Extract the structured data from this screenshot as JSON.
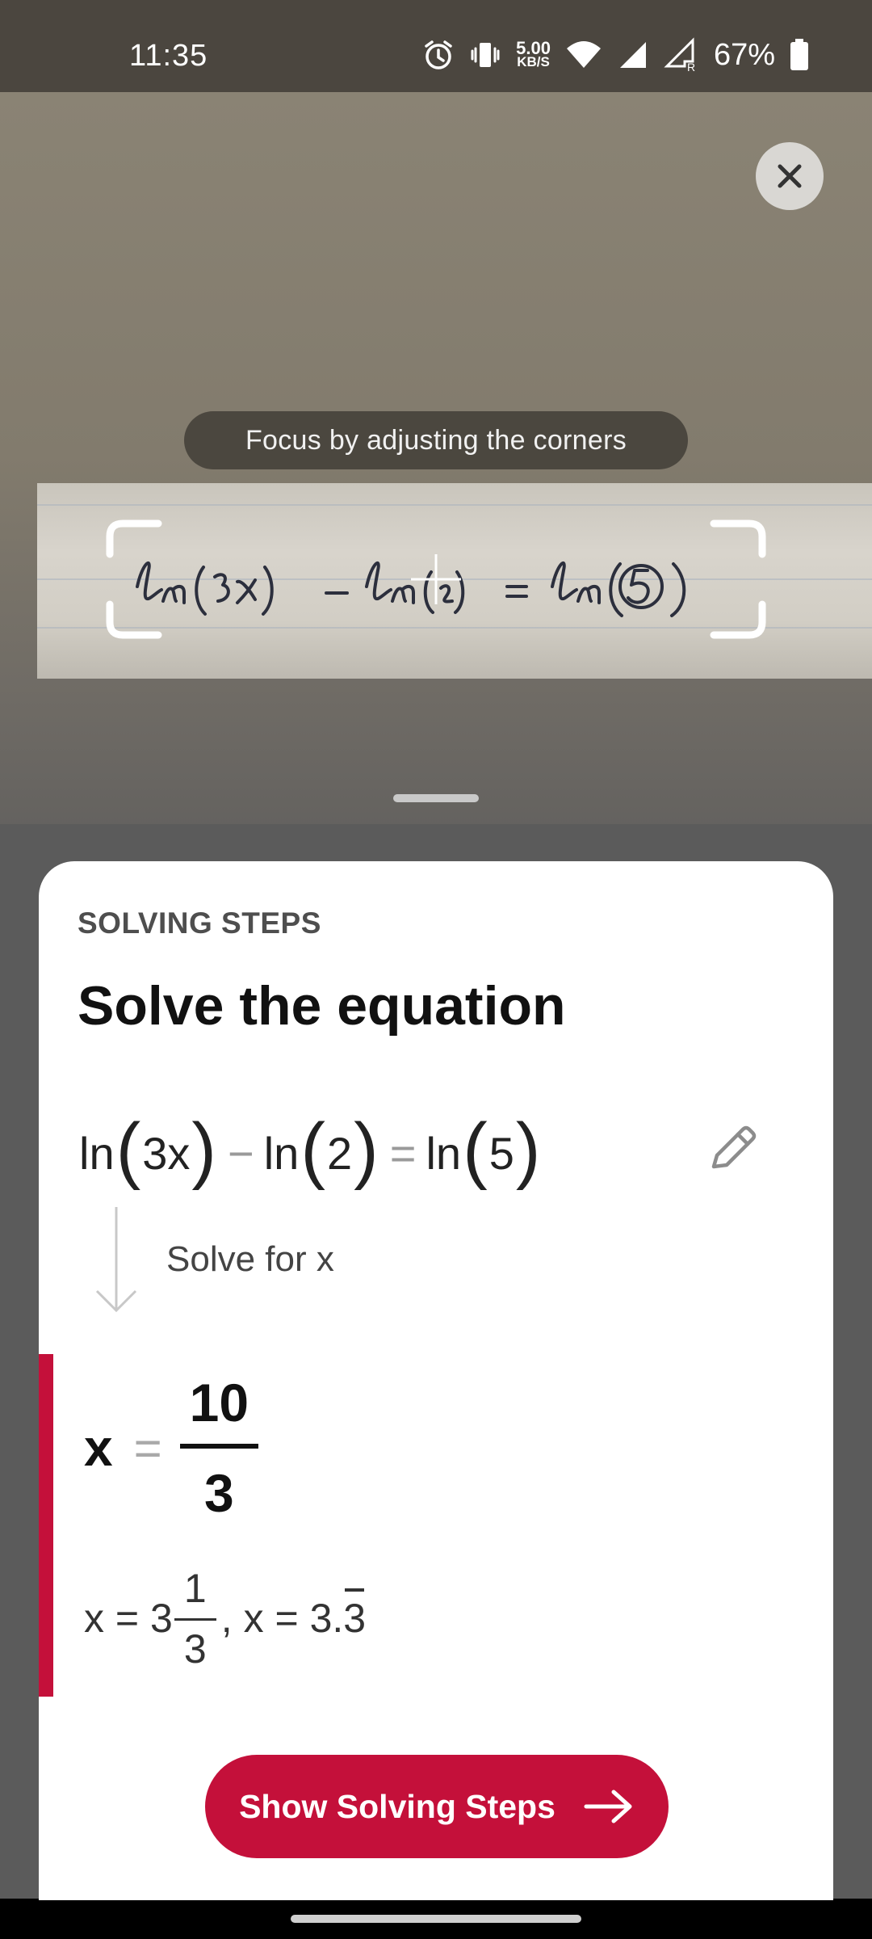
{
  "status_bar": {
    "time": "11:35",
    "net_speed_value": "5.00",
    "net_speed_unit": "KB/S",
    "battery": "67%",
    "icons": [
      "alarm-icon",
      "vibrate-icon",
      "wifi-icon",
      "signal-icon",
      "signal-roaming-icon",
      "battery-icon"
    ]
  },
  "camera": {
    "hint": "Focus by adjusting the corners",
    "handwritten_text": "ln(3x) - ln(2) = ln(5)"
  },
  "sheet": {
    "section_label": "SOLVING STEPS",
    "title": "Solve the equation",
    "equation": {
      "f1": "ln",
      "a1": "3x",
      "minus": "−",
      "f2": "ln",
      "a2": "2",
      "equals": "=",
      "f3": "ln",
      "a3": "5"
    },
    "step_label": "Solve for x",
    "result": {
      "variable": "x",
      "equals": "=",
      "numerator": "10",
      "denominator": "3"
    },
    "alternatives": {
      "mixed_prefix": "x = 3",
      "mixed_num": "1",
      "mixed_den": "3",
      "separator": ", x = 3.",
      "repeating_digit": "3"
    },
    "cta_label": "Show Solving Steps"
  },
  "colors": {
    "accent": "#c4103a",
    "status_bar": "#4b463f",
    "sheet_bg": "#ffffff"
  }
}
